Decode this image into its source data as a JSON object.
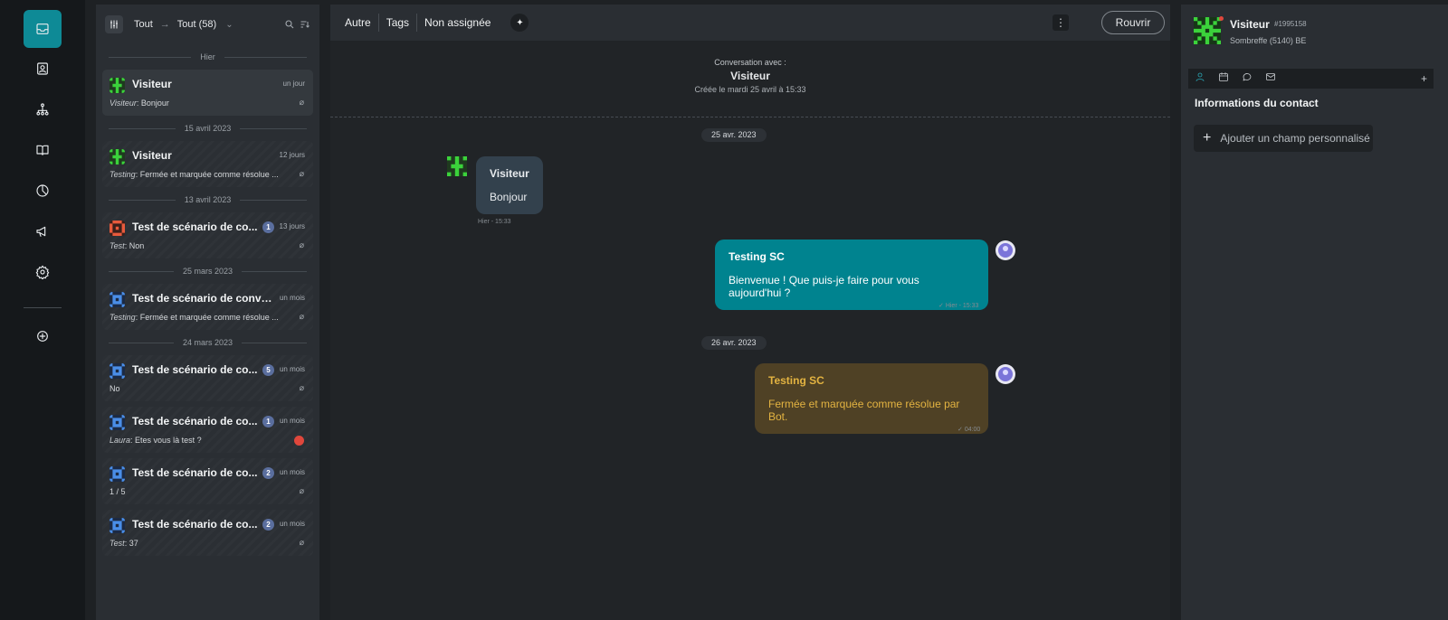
{
  "list": {
    "filter_from": "Tout",
    "filter_to": "Tout (58)",
    "separators": [
      "Hier",
      "15 avril 2023",
      "13 avril 2023",
      "25 mars 2023",
      "24 mars 2023"
    ],
    "conversations": [
      {
        "name": "Visiteur",
        "time": "un jour",
        "author": "Visiteur",
        "preview": "Bonjour",
        "badge": "",
        "avatar": "green"
      },
      {
        "name": "Visiteur",
        "time": "12 jours",
        "author": "Testing",
        "preview": "Fermée et marquée comme résolue ...",
        "badge": "",
        "avatar": "green"
      },
      {
        "name": "Test de scénario de co...",
        "time": "13 jours",
        "author": "Test",
        "preview": "Non",
        "badge": "1",
        "avatar": "red"
      },
      {
        "name": "Test de scénario de conver...",
        "time": "un mois",
        "author": "Testing",
        "preview": "Fermée et marquée comme résolue ...",
        "badge": "",
        "avatar": "blue"
      },
      {
        "name": "Test de scénario de co...",
        "time": "un mois",
        "author": "",
        "preview": "No",
        "badge": "5",
        "avatar": "blue"
      },
      {
        "name": "Test de scénario de co...",
        "time": "un mois",
        "author": "Laura",
        "preview": "Etes vous là test ?",
        "badge": "1",
        "avatar": "blue"
      },
      {
        "name": "Test de scénario de co...",
        "time": "un mois",
        "author": "",
        "preview": "1 / 5",
        "badge": "2",
        "avatar": "blue"
      },
      {
        "name": "Test de scénario de co...",
        "time": "un mois",
        "author": "Test",
        "preview": "37",
        "badge": "2",
        "avatar": "blue"
      }
    ]
  },
  "toolbar": {
    "other": "Autre",
    "tags": "Tags",
    "unassigned": "Non assignée",
    "more": "⋮",
    "reopen": "Rouvrir"
  },
  "intro": {
    "line1": "Conversation avec :",
    "name": "Visiteur",
    "created": "Créée le mardi 25 avril à 15:33"
  },
  "messages": {
    "date1": "25 avr. 2023",
    "m1": {
      "author": "Visiteur",
      "text": "Bonjour",
      "meta": "Hier - 15:33"
    },
    "m2": {
      "author": "Testing SC",
      "text": "Bienvenue ! Que puis-je faire pour vous aujourd'hui ?",
      "meta": "Hier - 15:33"
    },
    "date2": "26 avr. 2023",
    "m3": {
      "author": "Testing SC",
      "text": "Fermée et marquée comme résolue par Bot.",
      "meta": "04:00"
    }
  },
  "profile": {
    "name": "Visiteur",
    "id": "#1995158",
    "location": "Sombreffe (5140) BE",
    "section_title": "Informations du contact",
    "add_field": "Ajouter un champ personnalisé"
  },
  "colors": {
    "accent": "#0e8a96",
    "bubble_agent": "#00838f",
    "bubble_visitor": "#33414d",
    "bubble_note": "#4f4125",
    "note_text": "#e3b341"
  },
  "icons": {
    "rail": [
      "inbox-icon",
      "contacts-icon",
      "hierarchy-icon",
      "book-icon",
      "chart-pie-icon",
      "megaphone-icon",
      "settings-icon",
      "add-circle-icon"
    ]
  }
}
